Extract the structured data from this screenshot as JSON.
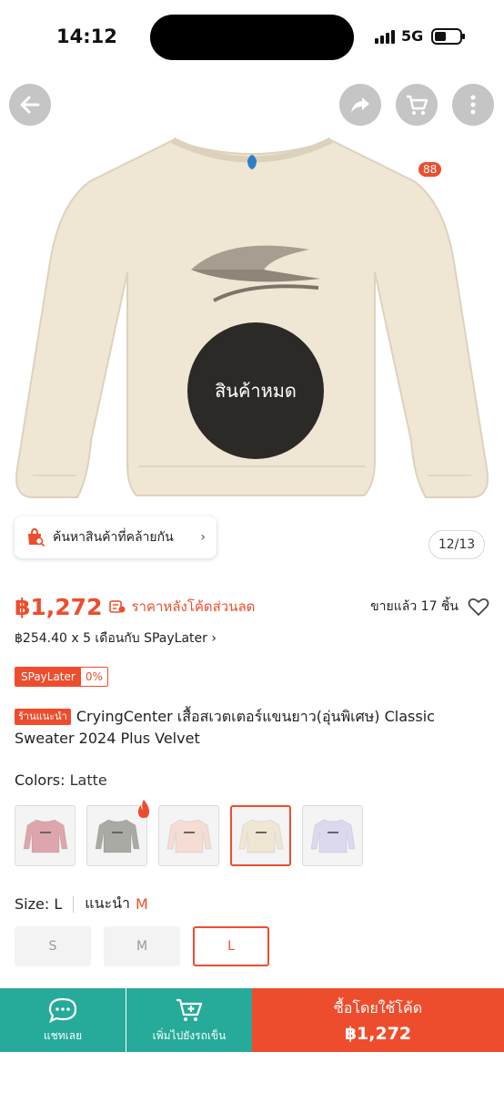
{
  "status": {
    "time": "14:12",
    "network": "5G"
  },
  "header": {
    "cart_count": "88"
  },
  "gallery": {
    "soldout_text": "สินค้าหมด",
    "similar_label": "ค้นหาสินค้าที่คล้ายกัน",
    "counter": "12/13"
  },
  "price": {
    "amount": "฿1,272",
    "discount_note": "ราคาหลังโค้ดส่วนลด",
    "sold": "ขายแล้ว 17 ชิ้น",
    "paylater": "฿254.40 x 5 เดือนกับ SPayLater",
    "spl_name": "SPayLater",
    "spl_rate": "0%"
  },
  "product": {
    "shop_badge": "ร้านแนะนำ",
    "title": "CryingCenter เสื้อสเวตเตอร์แขนยาว(อุ่นพิเศษ) Classic Sweater 2024 Plus Velvet"
  },
  "colors": {
    "label": "Colors:",
    "selected": "Latte",
    "options": [
      {
        "color": "#dca6ac"
      },
      {
        "color": "#a9aaa4"
      },
      {
        "color": "#f5ddd4"
      },
      {
        "color": "#efe6d4"
      },
      {
        "color": "#dcd9ef"
      }
    ]
  },
  "size": {
    "label": "Size:",
    "selected": "L",
    "recommend_label": "แนะนำ",
    "recommend_value": "M",
    "options": [
      "S",
      "M",
      "L"
    ]
  },
  "bottom": {
    "chat": "แชทเลย",
    "add_cart": "เพิ่มไปยังรถเข็น",
    "buy_label": "ซื้อโดยใช้โค้ด",
    "buy_price": "฿1,272"
  },
  "theme": {
    "accent": "#ee4d2d",
    "teal": "#26aa99",
    "product_color": "#efe6d4"
  }
}
